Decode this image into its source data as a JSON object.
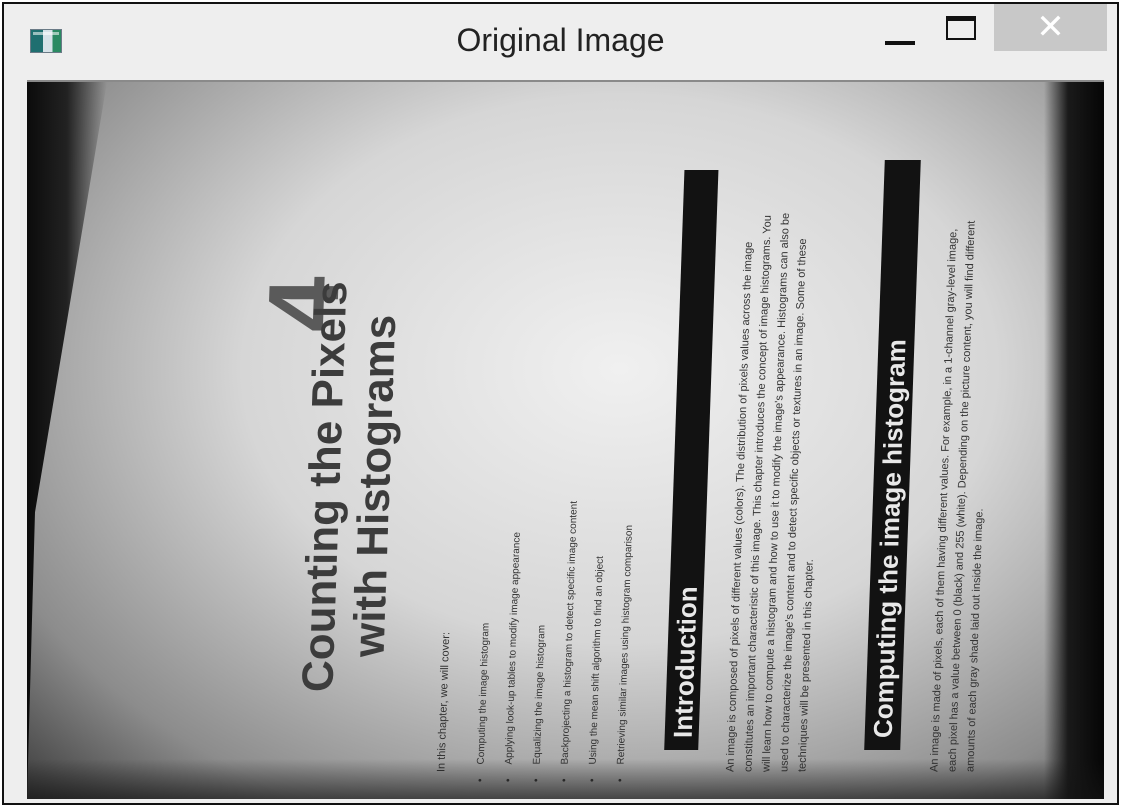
{
  "window": {
    "title": "Original Image",
    "close_label": "✕"
  },
  "image": {
    "chapter_number": "4",
    "chapter_title_line1": "Counting the Pixels",
    "chapter_title_line2": "with Histograms",
    "intro_line": "In this chapter, we will cover:",
    "bullets": [
      "Computing the image histogram",
      "Applying look-up tables to modify image appearance",
      "Equalizing the image histogram",
      "Backprojecting a histogram to detect specific image content",
      "Using the mean shift algorithm to find an object",
      "Retrieving similar images using histogram comparison"
    ],
    "section1_heading": "Introduction",
    "section1_text": "An image is composed of pixels of different values (colors). The distribution of pixels values across the image constitutes an important characteristic of this image. This chapter introduces the concept of image histograms. You will learn how to compute a histogram and how to use it to modify the image's appearance. Histograms can also be used to characterize the image's content and to detect specific objects or textures in an image. Some of these techniques will be presented in this chapter.",
    "section2_heading": "Computing the image histogram",
    "section2_text": "An image is made of pixels, each of them having different values. For example, in a 1-channel gray-level image, each pixel has a value between 0 (black) and 255 (white). Depending on the picture content, you will find different amounts of each gray shade laid out inside the image."
  }
}
